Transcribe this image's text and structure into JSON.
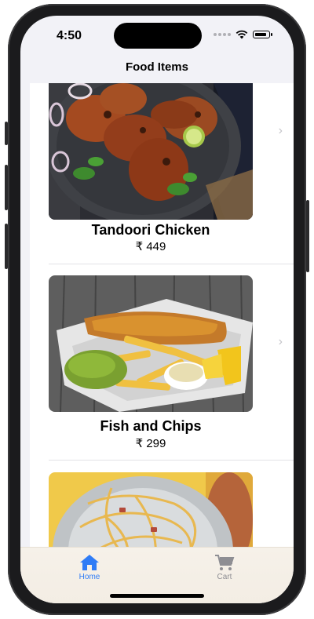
{
  "status_bar": {
    "time": "4:50"
  },
  "nav": {
    "title": "Food Items"
  },
  "items": [
    {
      "name": "Tandoori Chicken",
      "price": "₹ 449",
      "image": "tandoori-chicken-photo"
    },
    {
      "name": "Fish and Chips",
      "price": "₹ 299",
      "image": "fish-and-chips-photo"
    },
    {
      "name": "",
      "price": "",
      "image": "spaghetti-carbonara-photo"
    }
  ],
  "tabs": [
    {
      "label": "Home",
      "icon": "home-icon",
      "selected": true
    },
    {
      "label": "Cart",
      "icon": "cart-icon",
      "selected": false
    }
  ],
  "colors": {
    "accent": "#2f7cf6",
    "inactive": "#8e8e93",
    "list_bg": "#f2f2f7"
  }
}
